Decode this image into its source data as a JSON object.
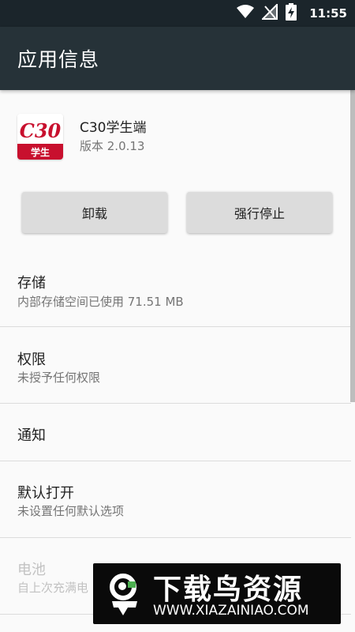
{
  "status_bar": {
    "time": "11:55",
    "icons": [
      "wifi-icon",
      "no-signal-icon",
      "battery-charging-icon"
    ]
  },
  "app_bar": {
    "title": "应用信息"
  },
  "app": {
    "name": "C30学生端",
    "version": "版本 2.0.13",
    "icon_text": "C30",
    "icon_sub": "学生",
    "icon_color": "#c8102e"
  },
  "buttons": {
    "uninstall": "卸载",
    "force_stop": "强行停止"
  },
  "settings": [
    {
      "title": "存储",
      "summary": "内部存储空间已使用 71.51 MB",
      "enabled": true
    },
    {
      "title": "权限",
      "summary": "未授予任何权限",
      "enabled": true
    },
    {
      "title": "通知",
      "summary": "",
      "enabled": true
    },
    {
      "title": "默认打开",
      "summary": "未设置任何默认选项",
      "enabled": true
    },
    {
      "title": "电池",
      "summary": "自上次充满电",
      "enabled": false
    }
  ],
  "watermark": {
    "title": "下载鸟资源",
    "url": "WWW.XIAZAINIAO.COM"
  }
}
